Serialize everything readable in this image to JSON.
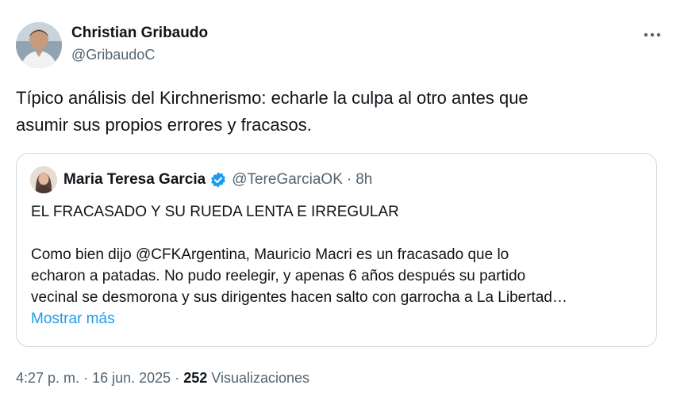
{
  "author": {
    "name": "Christian Gribaudo",
    "handle": "@GribaudoC"
  },
  "tweet": {
    "text_line1": "Típico análisis del Kirchnerismo: echarle la culpa al otro antes que",
    "text_line2": "asumir sus propios errores y fracasos."
  },
  "quoted": {
    "name": "Maria Teresa Garcia",
    "handle": "@TereGarciaOK",
    "separator": "·",
    "time": "8h",
    "line1": "EL FRACASADO Y SU RUEDA LENTA E IRREGULAR",
    "line2": "Como bien dijo @CFKArgentina, Mauricio Macri es un fracasado que lo",
    "line3": "echaron a patadas. No pudo reelegir, y apenas 6 años después su partido",
    "line4": "vecinal se desmorona y sus dirigentes hacen salto con garrocha a La Libertad…",
    "show_more": "Mostrar más"
  },
  "meta": {
    "time": "4:27 p. m.",
    "sep1": "·",
    "date": "16 jun. 2025",
    "sep2": "·",
    "views_count": "252",
    "views_label": "Visualizaciones"
  },
  "icons": {
    "more": "more-horizontal-icon",
    "verified": "verified-badge-icon"
  },
  "colors": {
    "text": "#0f1419",
    "secondary": "#536471",
    "link": "#1d9bf0",
    "border": "#cfd9de"
  }
}
